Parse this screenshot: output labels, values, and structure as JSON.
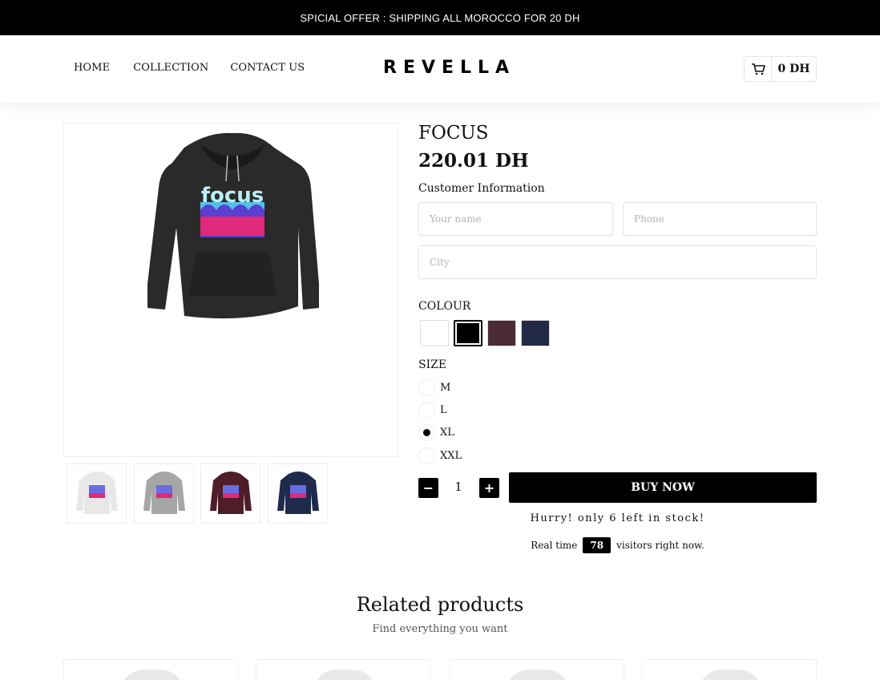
{
  "announcement": "SPICIAL OFFER : SHIPPING ALL MOROCCO FOR 20 DH",
  "nav": {
    "items": [
      "HOME",
      "COLLECTION",
      "CONTACT US"
    ]
  },
  "brand": "REVELLA",
  "cart": {
    "icon": "cart-icon",
    "total": "0 DH"
  },
  "product": {
    "title": "FOCUS",
    "price": "220.01 DH",
    "customer_info_label": "Customer Information",
    "fields": {
      "name_placeholder": "Your name",
      "phone_placeholder": "Phone",
      "city_placeholder": "City"
    },
    "colour_label": "COLOUR",
    "colours": [
      {
        "name": "white",
        "hex": "#ffffff",
        "selected": false
      },
      {
        "name": "black",
        "hex": "#000000",
        "selected": true
      },
      {
        "name": "maroon",
        "hex": "#4a2a33",
        "selected": false
      },
      {
        "name": "navy",
        "hex": "#232a45",
        "selected": false
      }
    ],
    "size_label": "SIZE",
    "sizes": [
      {
        "label": "M",
        "selected": false
      },
      {
        "label": "L",
        "selected": false
      },
      {
        "label": "XL",
        "selected": true
      },
      {
        "label": "XXL",
        "selected": false
      }
    ],
    "quantity": "1",
    "minus": "−",
    "plus": "+",
    "buy_label": "BUY NOW",
    "stock_text": "Hurry! only 6 left in stock!",
    "visitors": {
      "prefix": "Real time",
      "count": "78",
      "suffix": "visitors right now."
    },
    "hoodie_print": "focus"
  },
  "related": {
    "title": "Related products",
    "subtitle": "Find everything you want"
  }
}
